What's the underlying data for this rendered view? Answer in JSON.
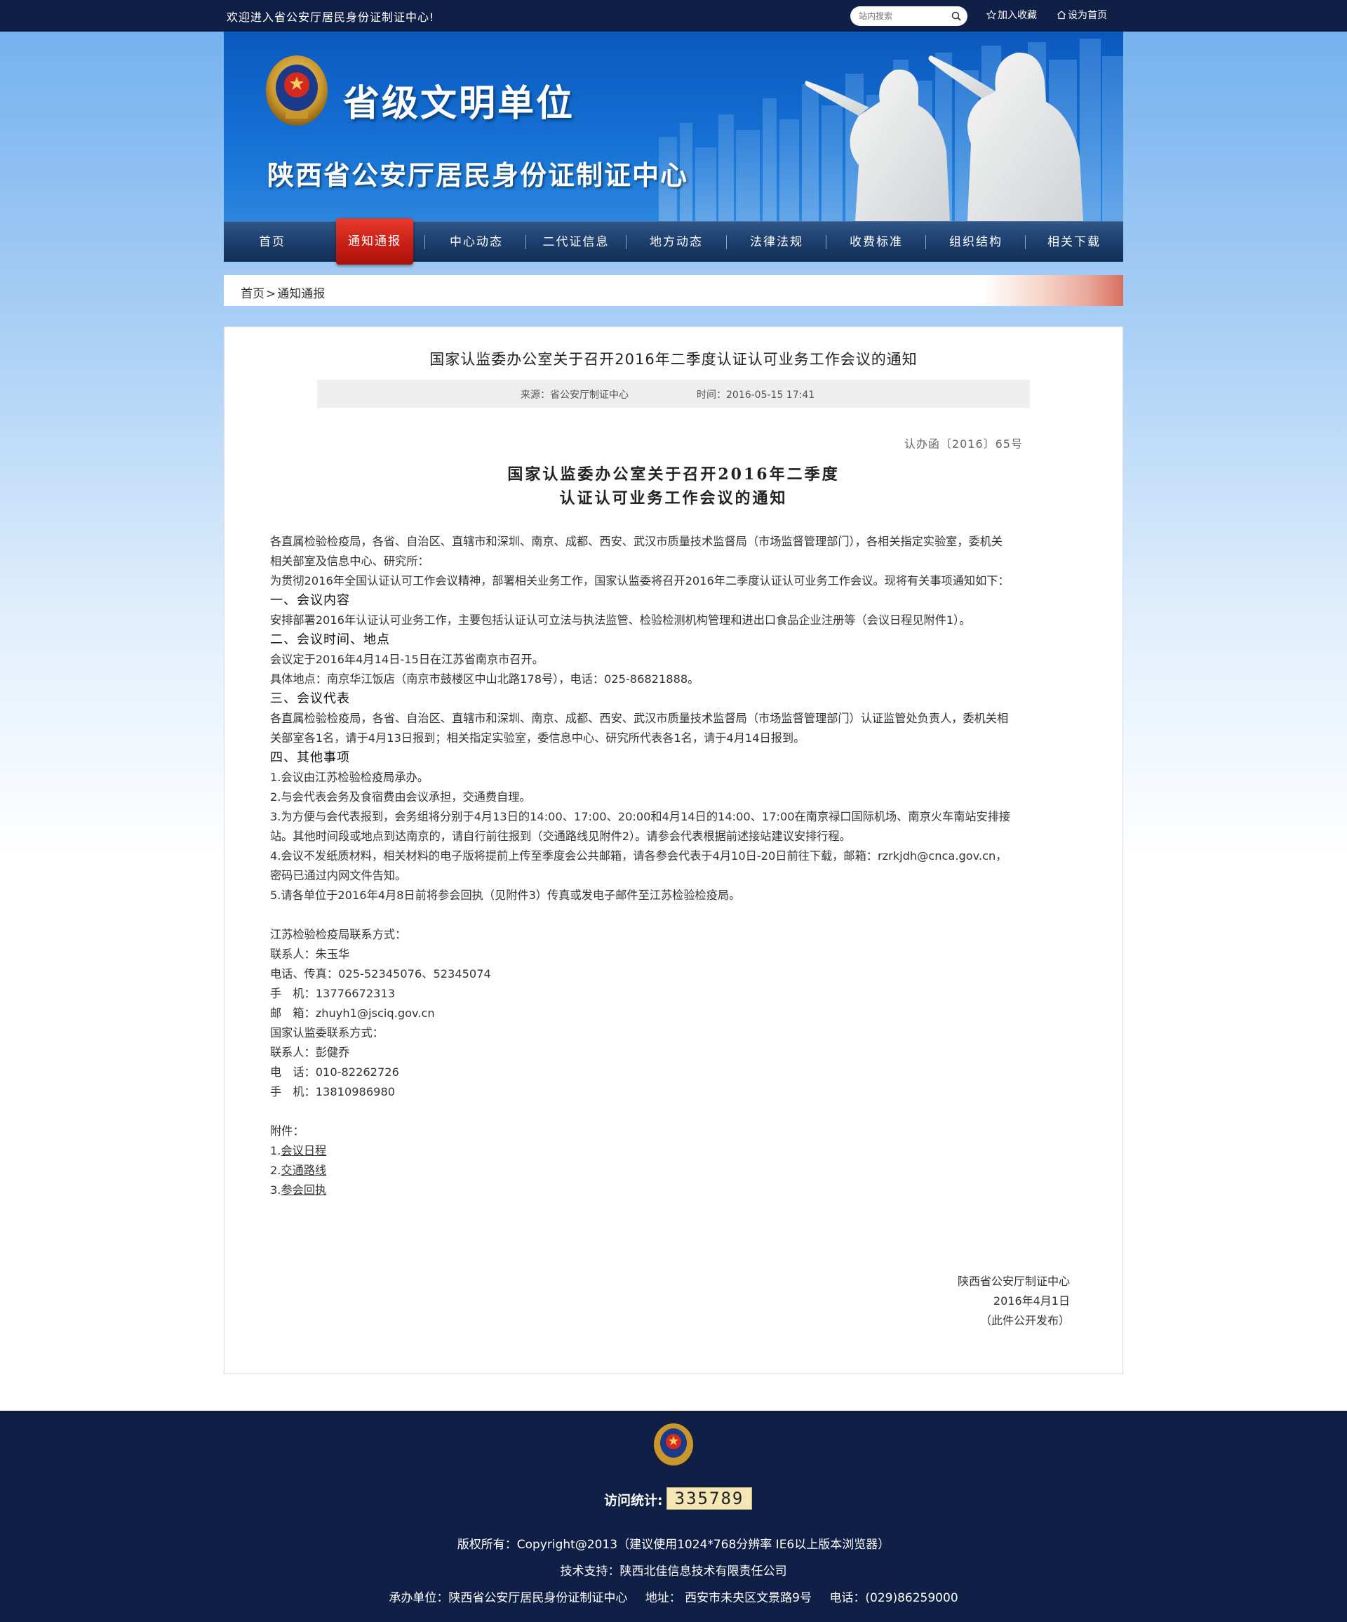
{
  "topbar": {
    "welcome": "欢迎进入省公安厅居民身份证制证中心!",
    "search_placeholder": "站内搜索",
    "fav_label": "加入收藏",
    "home_label": "设为首页"
  },
  "banner": {
    "title": "省级文明单位",
    "subtitle": "陕西省公安厅居民身份证制证中心"
  },
  "nav": {
    "items": [
      "首页",
      "通知通报",
      "中心动态",
      "二代证信息",
      "地方动态",
      "法律法规",
      "收费标准",
      "组织结构",
      "相关下载"
    ],
    "active_index": 1
  },
  "breadcrumb": {
    "home": "首页",
    "sep": ">",
    "current": "通知通报"
  },
  "article": {
    "title": "国家认监委办公室关于召开2016年二季度认证认可业务工作会议的通知",
    "source": "来源：省公安厅制证中心",
    "time": "时间：2016-05-15 17:41",
    "doc_no": "认办函〔2016〕65号",
    "doc_title_1": "国家认监委办公室关于召开2016年二季度",
    "doc_title_2": "认证认可业务工作会议的通知",
    "lines": [
      "各直属检验检疫局，各省、自治区、直辖市和深圳、南京、成都、西安、武汉市质量技术监督局（市场监督管理部门），各相关指定实验室，委机关",
      "相关部室及信息中心、研究所：",
      "为贯彻2016年全国认证认可工作会议精神，部署相关业务工作，国家认监委将召开2016年二季度认证认可业务工作会议。现将有关事项通知如下：",
      "一、会议内容",
      "安排部署2016年认证认可业务工作，主要包括认证认可立法与执法监管、检验检测机构管理和进出口食品企业注册等（会议日程见附件1）。",
      "二、会议时间、地点",
      "会议定于2016年4月14日-15日在江苏省南京市召开。",
      "具体地点：南京华江饭店（南京市鼓楼区中山北路178号），电话：025-86821888。",
      "三、会议代表",
      "各直属检验检疫局，各省、自治区、直辖市和深圳、南京、成都、西安、武汉市质量技术监督局（市场监督管理部门）认证监管处负责人，委机关相",
      "关部室各1名，请于4月13日报到；相关指定实验室，委信息中心、研究所代表各1名，请于4月14日报到。",
      "四、其他事项",
      "1.会议由江苏检验检疫局承办。",
      "2.与会代表会务及食宿费由会议承担，交通费自理。",
      "3.为方便与会代表报到，会务组将分别于4月13日的14:00、17:00、20:00和4月14日的14:00、17:00在南京禄口国际机场、南京火车南站安排接",
      "站。其他时间段或地点到达南京的，请自行前往报到（交通路线见附件2）。请参会代表根据前述接站建议安排行程。",
      "4.会议不发纸质材料，相关材料的电子版将提前上传至季度会公共邮箱，请各参会代表于4月10日-20日前往下载，邮箱：rzrkjdh@cnca.gov.cn，",
      "密码已通过内网文件告知。",
      "5.请各单位于2016年4月8日前将参会回执（见附件3）传真或发电子邮件至江苏检验检疫局。"
    ],
    "contacts": [
      "江苏检验检疫局联系方式：",
      "联系人：朱玉华",
      "电话、传真：025-52345076、52345074",
      "手　机：13776672313",
      "邮　箱：zhuyh1@jsciq.gov.cn",
      "国家认监委联系方式：",
      "联系人：彭健乔",
      "电　话：010-82262726",
      "手　机：13810986980"
    ],
    "attach_label": "附件：",
    "attachments": [
      {
        "num": "1.",
        "name": "会议日程"
      },
      {
        "num": "2.",
        "name": "交通路线"
      },
      {
        "num": "3.",
        "name": "参会回执"
      }
    ],
    "sign_org": "陕西省公安厅制证中心",
    "sign_date": "2016年4月1日",
    "sign_note": "（此件公开发布）"
  },
  "footer": {
    "visit_label": "访问统计:",
    "visit_count": "335789",
    "copyright": "版权所有：Copyright@2013（建议使用1024*768分辨率  IE6以上版本浏览器）",
    "support": "技术支持：陕西北佳信息技术有限责任公司",
    "host": "承办单位：陕西省公安厅居民身份证制证中心",
    "address": "地址： 西安市未央区文景路9号",
    "phone": "电话：(029)86259000"
  },
  "colors": {
    "topbar_bg": "#0f1f45",
    "banner_blue": "#0b58be",
    "nav_bg": "#1d3e6d",
    "nav_active": "#c51d14",
    "footer_bg": "#0f1f45",
    "counter_bg": "#f5e7b5"
  }
}
